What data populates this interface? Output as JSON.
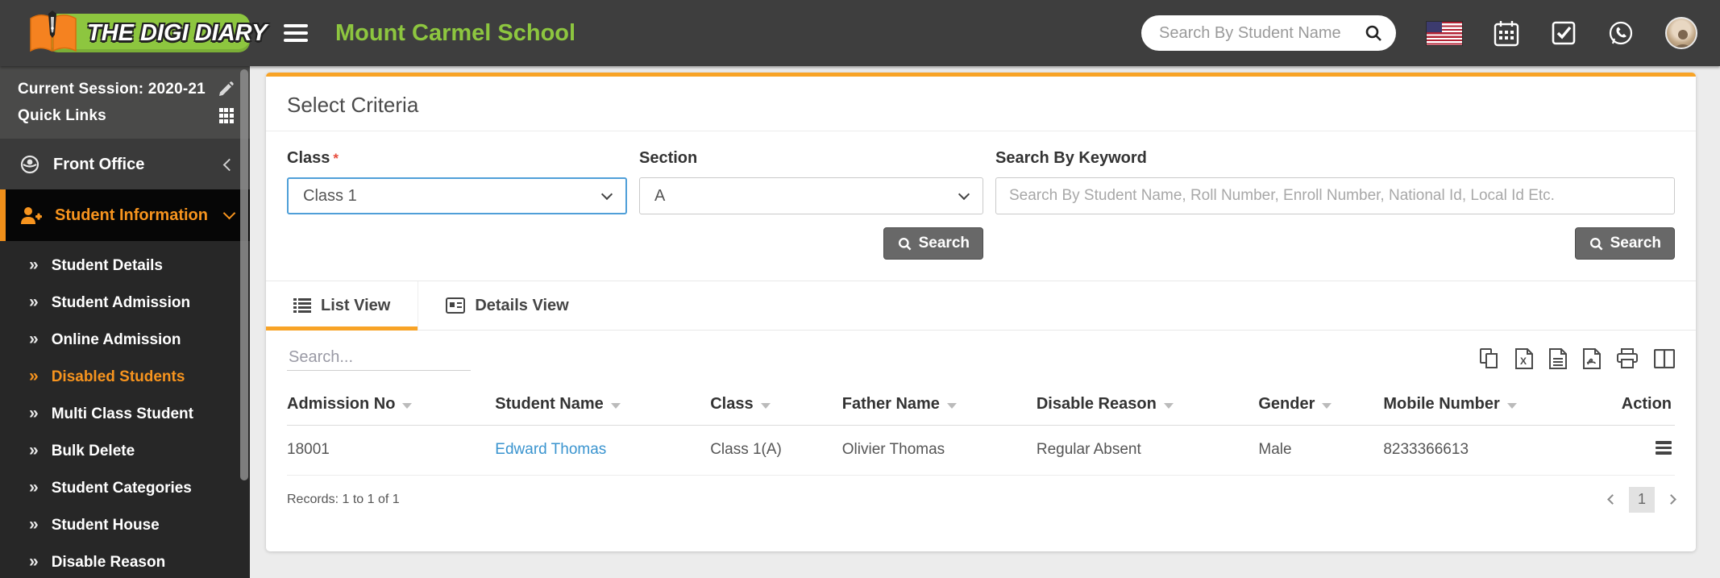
{
  "header": {
    "logo_text": "THE DIGI DIARY",
    "school_name": "Mount Carmel School",
    "search_placeholder": "Search By Student Name",
    "colors": {
      "header_bg": "#3e3e3e",
      "brand_green": "#8dc63f",
      "accent_orange": "#f7941e"
    }
  },
  "sidebar": {
    "session_label": "Current Session: 2020-21",
    "quick_links_label": "Quick Links",
    "menu": [
      {
        "label": "Front Office"
      },
      {
        "label": "Student Information",
        "active": true
      }
    ],
    "submenu": [
      {
        "label": "Student Details"
      },
      {
        "label": "Student Admission"
      },
      {
        "label": "Online Admission"
      },
      {
        "label": "Disabled Students",
        "active": true
      },
      {
        "label": "Multi Class Student"
      },
      {
        "label": "Bulk Delete"
      },
      {
        "label": "Student Categories"
      },
      {
        "label": "Student House"
      },
      {
        "label": "Disable Reason"
      }
    ]
  },
  "criteria": {
    "title": "Select Criteria",
    "class_label": "Class",
    "required_mark": "*",
    "class_value": "Class 1",
    "section_label": "Section",
    "section_value": "A",
    "keyword_label": "Search By Keyword",
    "keyword_placeholder": "Search By Student Name, Roll Number, Enroll Number, National Id, Local Id Etc.",
    "search_button_label": "Search"
  },
  "tabs": [
    {
      "label": "List View",
      "active": true
    },
    {
      "label": "Details View",
      "active": false
    }
  ],
  "table": {
    "search_placeholder": "Search...",
    "columns": [
      "Admission No",
      "Student Name",
      "Class",
      "Father Name",
      "Disable Reason",
      "Gender",
      "Mobile Number",
      "Action"
    ],
    "rows": [
      [
        "18001",
        "Edward Thomas",
        "Class 1(A)",
        "Olivier Thomas",
        "Regular Absent",
        "Male",
        "8233366613"
      ]
    ],
    "records_text": "Records: 1 to 1 of 1",
    "pagination": {
      "current_page": "1"
    }
  }
}
